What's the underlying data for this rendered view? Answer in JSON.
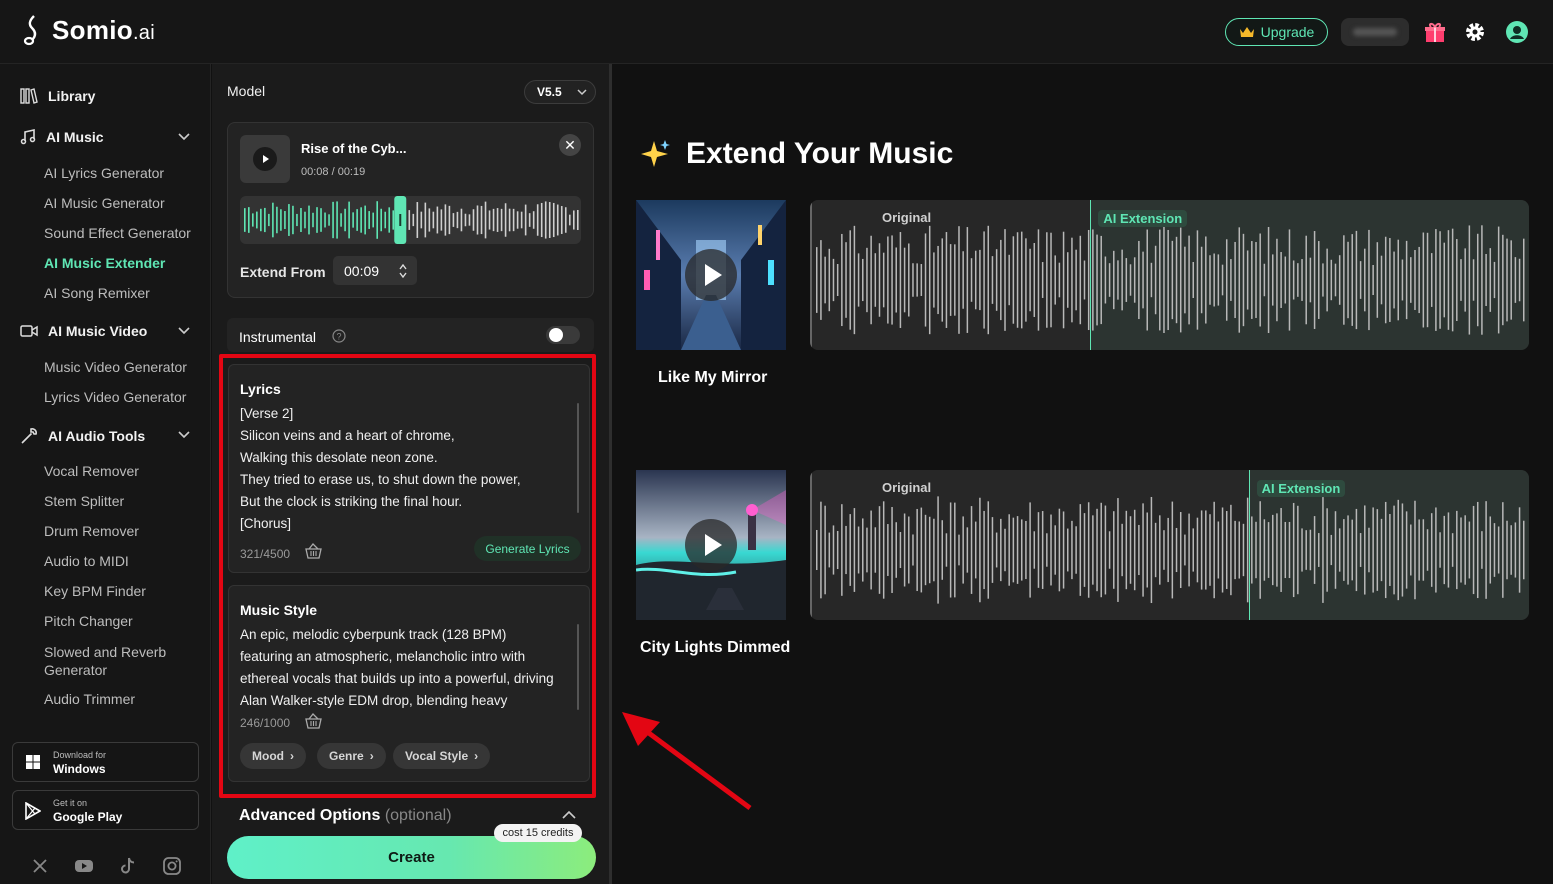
{
  "app": {
    "name": "Somio",
    "name_suffix": ".ai"
  },
  "header": {
    "upgrade_label": "Upgrade"
  },
  "sidebar": {
    "library": "Library",
    "ai_music": {
      "label": "AI Music",
      "items": [
        "AI Lyrics Generator",
        "AI Music Generator",
        "Sound Effect Generator",
        "AI Music Extender",
        "AI Song Remixer"
      ],
      "active": "AI Music Extender"
    },
    "ai_music_video": {
      "label": "AI Music Video",
      "items": [
        "Music Video Generator",
        "Lyrics Video Generator"
      ]
    },
    "ai_audio_tools": {
      "label": "AI Audio Tools",
      "items": [
        "Vocal Remover",
        "Stem Splitter",
        "Drum Remover",
        "Audio to MIDI",
        "Key BPM Finder",
        "Pitch Changer",
        "Slowed and Reverb Generator",
        "Audio Trimmer"
      ]
    },
    "windows": {
      "small": "Download for",
      "big": "Windows"
    },
    "google_play": {
      "small": "Get it on",
      "big": "Google Play"
    }
  },
  "panel": {
    "model_label": "Model",
    "model_value": "V5.5",
    "track": {
      "title": "Rise of the Cyb...",
      "time": "00:08 / 00:19",
      "progress": 0.47
    },
    "extend_from_label": "Extend From",
    "extend_from_value": "00:09",
    "instrumental_label": "Instrumental",
    "instrumental_on": false,
    "lyrics": {
      "title": "Lyrics",
      "text": "[Verse 2]\nSilicon veins and a heart of chrome,\nWalking this desolate neon zone.\nThey tried to erase us, to shut down the power,\nBut the clock is striking the final hour.\n[Chorus]",
      "count": "321/4500",
      "generate_label": "Generate Lyrics"
    },
    "music_style": {
      "title": "Music Style",
      "text": "An epic, melodic cyberpunk track (128 BPM)\nfeaturing an atmospheric, melancholic intro with\nethereal vocals that builds up into a powerful, driving\nAlan Walker-style EDM drop, blending heavy",
      "count": "246/1000",
      "chips": [
        "Mood",
        "Genre",
        "Vocal Style"
      ]
    },
    "advanced_label": "Advanced Options",
    "advanced_optional": "(optional)",
    "cost_label": "cost 15 credits",
    "create_label": "Create"
  },
  "main": {
    "title": "Extend Your Music",
    "examples": [
      {
        "name": "Like My Mirror",
        "original_label": "Original",
        "extension_label": "AI Extension",
        "split": 0.39
      },
      {
        "name": "City Lights Dimmed",
        "original_label": "Original",
        "extension_label": "AI Extension",
        "split": 0.61
      }
    ]
  },
  "colors": {
    "accent": "#5fe6b4",
    "highlight": "#e30613",
    "background": "#111111"
  }
}
